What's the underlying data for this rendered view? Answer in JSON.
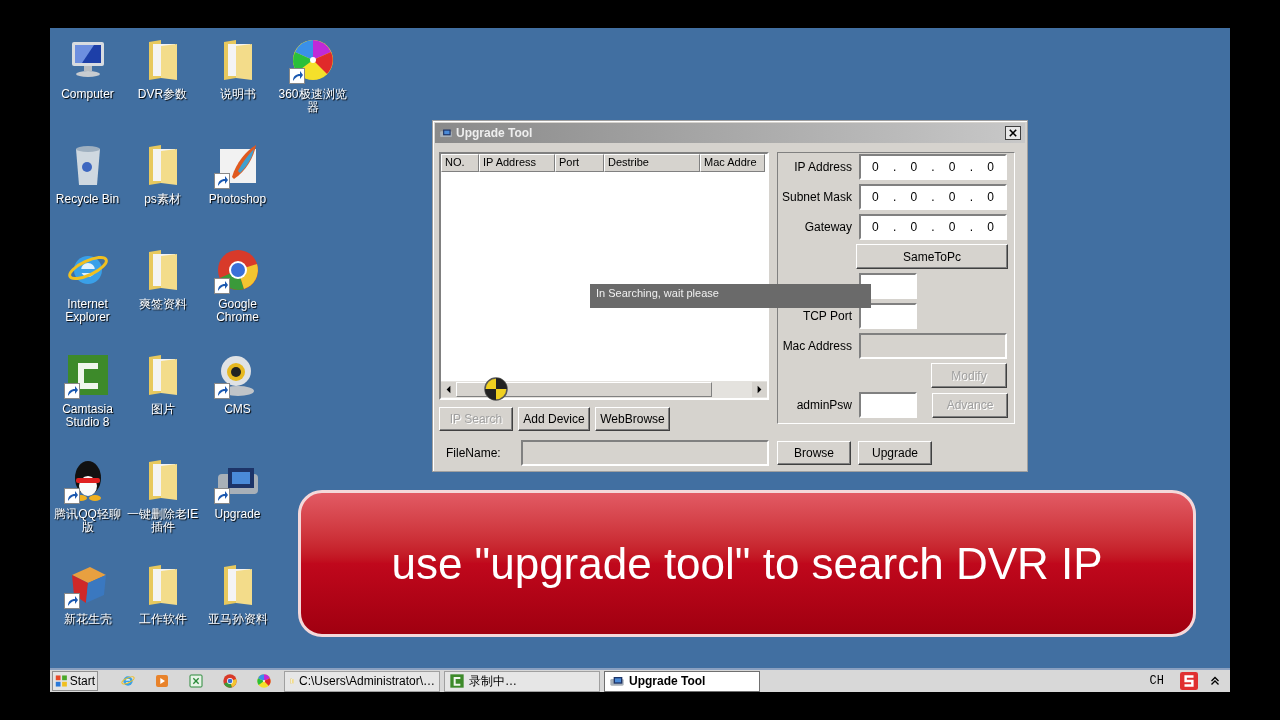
{
  "desktop": {
    "icon_columns": [
      {
        "icons": [
          {
            "label": "Computer",
            "kind": "computer",
            "shortcut": false
          },
          {
            "label": "Recycle Bin",
            "kind": "recycle",
            "shortcut": false
          },
          {
            "label": "Internet Explorer",
            "kind": "ie",
            "shortcut": false
          },
          {
            "label": "Camtasia Studio 8",
            "kind": "camtasia",
            "shortcut": true
          },
          {
            "label": "腾讯QQ轻聊版",
            "kind": "penguin",
            "shortcut": true
          },
          {
            "label": "新花生壳",
            "kind": "cube",
            "shortcut": true
          }
        ]
      },
      {
        "icons": [
          {
            "label": "DVR参数",
            "kind": "folder",
            "shortcut": false
          },
          {
            "label": "ps素材",
            "kind": "folder",
            "shortcut": false
          },
          {
            "label": "爽签资料",
            "kind": "folder",
            "shortcut": false
          },
          {
            "label": "图片",
            "kind": "folder",
            "shortcut": false
          },
          {
            "label": "一键删除老IE插件",
            "kind": "folder",
            "shortcut": false
          },
          {
            "label": "工作软件",
            "kind": "folder",
            "shortcut": false
          }
        ]
      },
      {
        "icons": [
          {
            "label": "说明书",
            "kind": "folder",
            "shortcut": false
          },
          {
            "label": "Photoshop",
            "kind": "photoshop",
            "shortcut": true
          },
          {
            "label": "Google Chrome",
            "kind": "chrome",
            "shortcut": true
          },
          {
            "label": "CMS",
            "kind": "webcam",
            "shortcut": true
          },
          {
            "label": "Upgrade",
            "kind": "upgrade",
            "shortcut": true
          },
          {
            "label": "亚马孙资料",
            "kind": "folder",
            "shortcut": false
          }
        ]
      },
      {
        "icons": [
          {
            "label": "360极速浏览器",
            "kind": "pinwheel",
            "shortcut": true
          }
        ]
      }
    ]
  },
  "window": {
    "title": "Upgrade Tool",
    "table": {
      "columns": [
        "NO.",
        "IP Address",
        "Port",
        "Destribe",
        "Mac Addre"
      ]
    },
    "overlay_message": "In Searching, wait please",
    "actions": [
      {
        "label": "IP Search",
        "disabled": true
      },
      {
        "label": "Add Device",
        "disabled": false
      },
      {
        "label": "WebBrowse",
        "disabled": false
      }
    ],
    "settings": {
      "ip_fields": [
        {
          "label": "IP Address",
          "parts": [
            "0",
            ".",
            "0",
            ".",
            "0",
            ".",
            "0"
          ]
        },
        {
          "label": "Subnet Mask",
          "parts": [
            "0",
            ".",
            "0",
            ".",
            "0",
            ".",
            "0"
          ]
        },
        {
          "label": "Gateway",
          "parts": [
            "0",
            ".",
            "0",
            ".",
            "0",
            ".",
            "0"
          ]
        }
      ],
      "same_button": {
        "label": "SameToPc",
        "disabled": false
      },
      "tcp_port": {
        "label": "TCP Port",
        "disabled": false
      },
      "mac_address": {
        "label": "Mac Address",
        "disabled": true
      },
      "modify_button": {
        "label": "Modify",
        "disabled": true
      },
      "admin_password": {
        "label": "adminPsw",
        "disabled": false
      },
      "advance_button": {
        "label": "Advance",
        "disabled": true
      }
    },
    "file": {
      "label": "FileName:",
      "buttons": [
        {
          "label": "Browse",
          "disabled": false
        },
        {
          "label": "Upgrade",
          "disabled": false
        }
      ]
    }
  },
  "caption": "use \"upgrade tool\" to search DVR IP",
  "taskbar": {
    "start": "Start",
    "quick_launch": [
      {
        "kind": "ie"
      },
      {
        "kind": "media"
      },
      {
        "kind": "excel"
      },
      {
        "kind": "chrome"
      },
      {
        "kind": "pinwheel"
      }
    ],
    "tasks": [
      {
        "label": "C:\\Users\\Administrator\\…",
        "kind": "folder",
        "selected": false
      },
      {
        "label": "录制中…",
        "kind": "camtasia",
        "selected": false
      },
      {
        "label": "Upgrade Tool",
        "kind": "upgrade",
        "selected": true
      }
    ],
    "language": "CH"
  }
}
